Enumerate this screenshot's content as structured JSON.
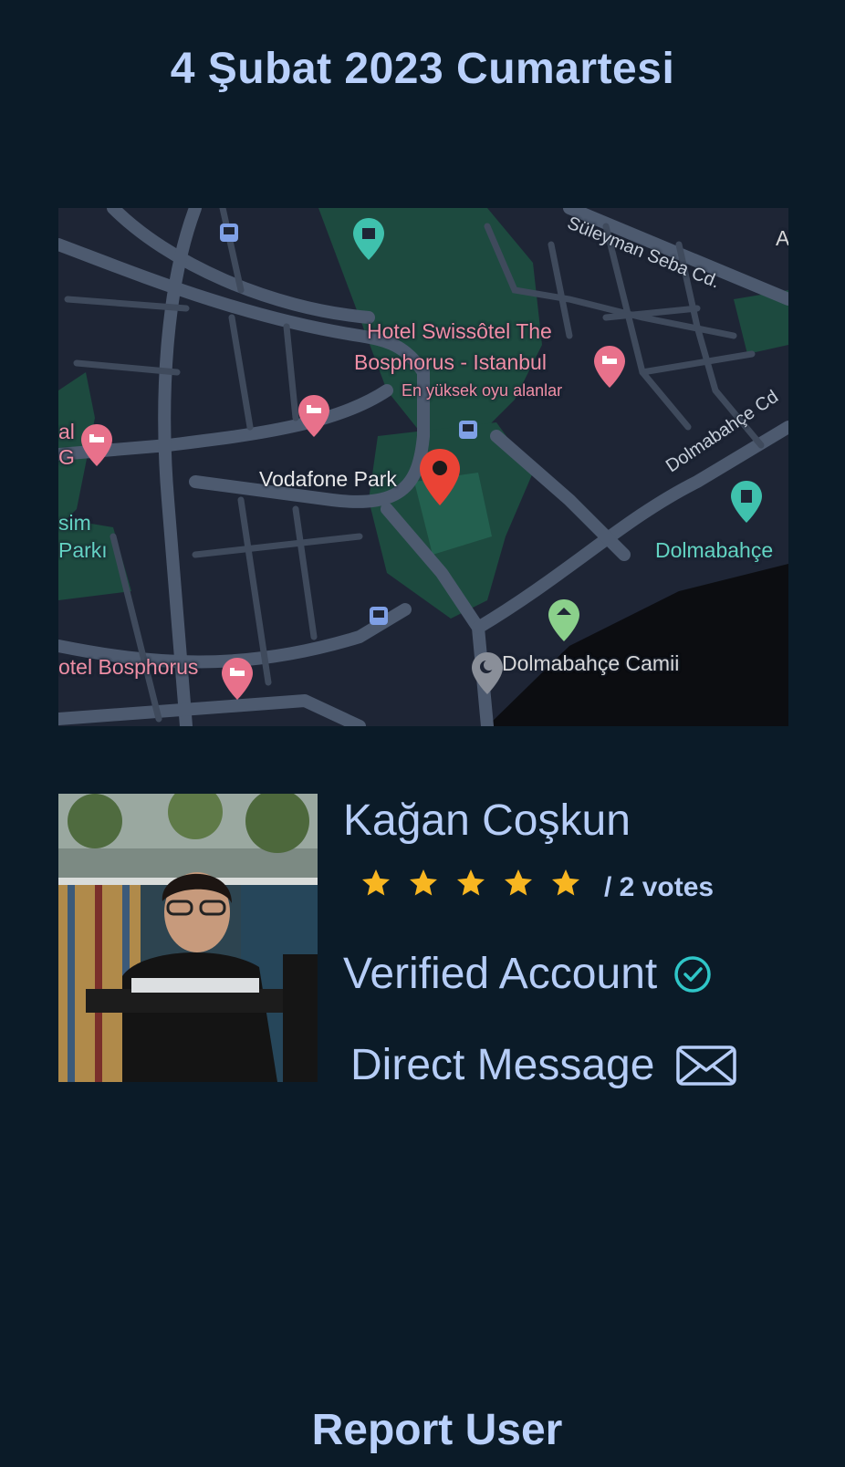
{
  "header": {
    "date": "4 Şubat 2023 Cumartesi"
  },
  "map": {
    "labels": {
      "hotel_swissotel_line1": "Hotel Swissôtel The",
      "hotel_swissotel_line2": "Bosphorus - Istanbul",
      "hotel_swissotel_sub": "En yüksek oyu alanlar",
      "vodafone_park": "Vodafone Park",
      "suleyman_seba": "Süleyman Seba Cd.",
      "dolmabahce_cd": "Dolmabahçe Cd",
      "dolmabahce": "Dolmabahçe",
      "dolmabahce_camii": "Dolmabahçe Camii",
      "hotel_bosphorus": "otel Bosphorus",
      "park_left_1": "sim",
      "park_left_2": "Parkı",
      "left_edge_1": "al",
      "left_edge_2": "G",
      "right_edge": "A"
    },
    "icons": [
      "hotel-pin-icon",
      "location-pin-icon",
      "bus-stop-icon",
      "landmark-icon",
      "mosque-icon",
      "park-icon"
    ]
  },
  "profile": {
    "name": "Kağan Coşkun",
    "rating_stars": 5,
    "rating_max": 5,
    "votes": "/ 2 votes",
    "verified_label": "Verified Account",
    "message_label": "Direct Message"
  },
  "actions": {
    "report_label": "Report User"
  },
  "colors": {
    "background": "#0b1b28",
    "text": "#b6cdf7",
    "star": "#f8b621",
    "verified": "#2fc6c8"
  }
}
